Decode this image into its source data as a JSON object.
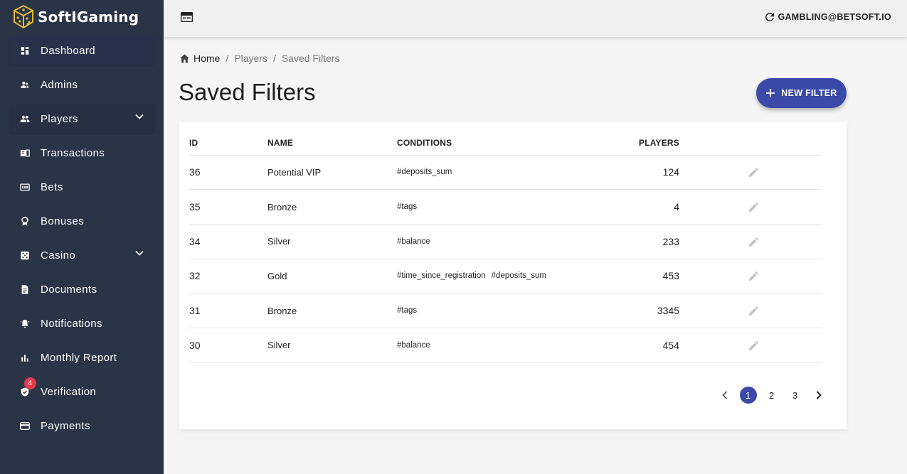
{
  "brand": {
    "name": "SoftIGaming"
  },
  "sidebar": {
    "items": [
      {
        "label": "Dashboard",
        "icon": "dashboard-icon"
      },
      {
        "label": "Admins",
        "icon": "admins-icon"
      },
      {
        "label": "Players",
        "icon": "players-icon",
        "expandable": true
      },
      {
        "label": "Transactions",
        "icon": "transactions-icon"
      },
      {
        "label": "Bets",
        "icon": "bets-icon"
      },
      {
        "label": "Bonuses",
        "icon": "bonuses-icon"
      },
      {
        "label": "Casino",
        "icon": "casino-icon",
        "expandable": true
      },
      {
        "label": "Documents",
        "icon": "documents-icon"
      },
      {
        "label": "Notifications",
        "icon": "notifications-icon"
      },
      {
        "label": "Monthly Report",
        "icon": "monthly-report-icon"
      },
      {
        "label": "Verification",
        "icon": "verification-icon",
        "badge": "4"
      },
      {
        "label": "Payments",
        "icon": "payments-icon"
      }
    ]
  },
  "topbar": {
    "user": "GAMBLING@BETSOFT.IO"
  },
  "breadcrumb": {
    "home": "Home",
    "section": "Players",
    "current": "Saved Filters",
    "separator": "/"
  },
  "page": {
    "title": "Saved Filters"
  },
  "actions": {
    "new_filter": "NEW FILTER"
  },
  "table": {
    "headers": {
      "id": "ID",
      "name": "NAME",
      "conditions": "CONDITIONS",
      "players": "PLAYERS"
    },
    "rows": [
      {
        "id": "36",
        "name": "Potential VIP",
        "conditions": [
          "#deposits_sum"
        ],
        "players": "124"
      },
      {
        "id": "35",
        "name": "Bronze",
        "conditions": [
          "#tags"
        ],
        "players": "4"
      },
      {
        "id": "34",
        "name": "Silver",
        "conditions": [
          "#balance"
        ],
        "players": "233"
      },
      {
        "id": "32",
        "name": "Gold",
        "conditions": [
          "#time_since_registration",
          "#deposits_sum"
        ],
        "players": "453"
      },
      {
        "id": "31",
        "name": "Bronze",
        "conditions": [
          "#tags"
        ],
        "players": "3345"
      },
      {
        "id": "30",
        "name": "Silver",
        "conditions": [
          "#balance"
        ],
        "players": "454"
      }
    ]
  },
  "pagination": {
    "pages": [
      "1",
      "2",
      "3"
    ],
    "current": "1"
  },
  "colors": {
    "sidebar_bg": "#2a3447",
    "accent": "#3b4aa8",
    "badge": "#e53950",
    "logo_gold": "#e8b931"
  }
}
